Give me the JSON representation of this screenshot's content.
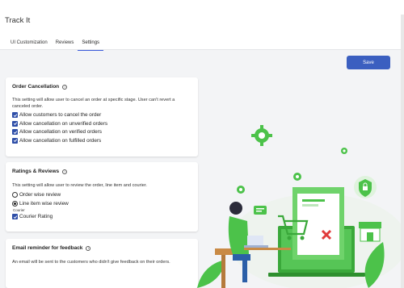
{
  "app": {
    "title": "Track It"
  },
  "tabs": [
    {
      "label": "UI Customization",
      "active": false
    },
    {
      "label": "Reviews",
      "active": false
    },
    {
      "label": "Settings",
      "active": true
    }
  ],
  "toolbar": {
    "save_label": "Save"
  },
  "order_cancellation": {
    "title": "Order Cancellation",
    "description": "This setting will allow user to cancel an order at specific stage. User can't revert a canceled order.",
    "options": [
      {
        "label": "Allow customers to cancel the order",
        "checked": true
      },
      {
        "label": "Allow cancellation on unverified orders",
        "checked": true
      },
      {
        "label": "Allow cancellation on verified orders",
        "checked": true
      },
      {
        "label": "Allow cancellation on fulfilled orders",
        "checked": true
      }
    ]
  },
  "ratings_reviews": {
    "title": "Ratings & Reviews",
    "description": "This setting will allow user to review the order, line item and courier.",
    "options": [
      {
        "label": "Order wise review",
        "selected": false
      },
      {
        "label": "Line item wise review",
        "selected": true
      }
    ],
    "courier_heading": "Courier",
    "courier_option": {
      "label": "Courier Rating",
      "checked": true
    }
  },
  "email_reminder": {
    "title": "Email reminder for feedback",
    "description": "An email will be sent to the customers who didn't give feedback on their orders."
  },
  "colors": {
    "accent": "#3b5fc0",
    "checkbox": "#2f4fa8",
    "illustration_green": "#4cc24a"
  }
}
